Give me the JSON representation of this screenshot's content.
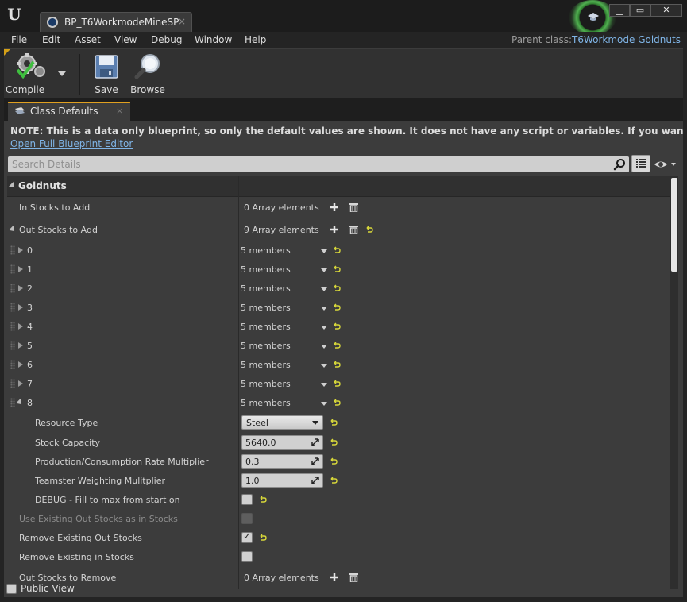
{
  "window": {
    "tab_title": "BP_T6WorkmodeMineSP",
    "tab_close": "×",
    "logo": "U",
    "controls": [
      "▁",
      "▭",
      "✕"
    ]
  },
  "menu": {
    "items": [
      "File",
      "Edit",
      "Asset",
      "View",
      "Debug",
      "Window",
      "Help"
    ],
    "parent_class_label": "Parent class:",
    "parent_class_value": "T6Workmode Goldnuts"
  },
  "toolbar": {
    "compile_label": "Compile",
    "save_label": "Save",
    "browse_label": "Browse"
  },
  "details_tab": {
    "label": "Class Defaults",
    "close": "×"
  },
  "note": {
    "text": "NOTE: This is a data only blueprint, so only the default values are shown.  It does not have any script or variables.  If you want to add some,",
    "link": "Open Full Blueprint Editor"
  },
  "search": {
    "placeholder": "Search Details",
    "value": ""
  },
  "category": {
    "label": "Goldnuts"
  },
  "rows": {
    "in_stocks": {
      "label": "In Stocks to Add",
      "value": "0 Array elements"
    },
    "out_stocks": {
      "label": "Out Stocks to Add",
      "value": "9 Array elements"
    },
    "elements": [
      {
        "index": "0",
        "value": "5 members"
      },
      {
        "index": "1",
        "value": "5 members"
      },
      {
        "index": "2",
        "value": "5 members"
      },
      {
        "index": "3",
        "value": "5 members"
      },
      {
        "index": "4",
        "value": "5 members"
      },
      {
        "index": "5",
        "value": "5 members"
      },
      {
        "index": "6",
        "value": "5 members"
      },
      {
        "index": "7",
        "value": "5 members"
      },
      {
        "index": "8",
        "value": "5 members"
      }
    ],
    "resource_type": {
      "label": "Resource Type",
      "value": "Steel"
    },
    "stock_capacity": {
      "label": "Stock Capacity",
      "value": "5640.0"
    },
    "production_rate": {
      "label": "Production/Consumption Rate Multiplier",
      "value": "0.3"
    },
    "teamster": {
      "label": "Teamster Weighting Mulitplier",
      "value": "1.0"
    },
    "debug_fill": {
      "label": "DEBUG - Fill to max from start on",
      "checked": false
    },
    "use_existing": {
      "label": "Use Existing Out Stocks as in Stocks",
      "checked": false,
      "enabled": false
    },
    "remove_out": {
      "label": "Remove Existing Out Stocks",
      "checked": true,
      "check_glyph": "✓"
    },
    "remove_in": {
      "label": "Remove Existing in Stocks",
      "checked": false
    },
    "out_remove": {
      "label": "Out Stocks to Remove",
      "value": "0 Array elements"
    }
  },
  "footer": {
    "public_view_label": "Public View",
    "public_view_checked": false
  },
  "colors": {
    "accent": "#e0a020",
    "link": "#7fb4e6",
    "reset_arrow": "#d8d83a"
  }
}
